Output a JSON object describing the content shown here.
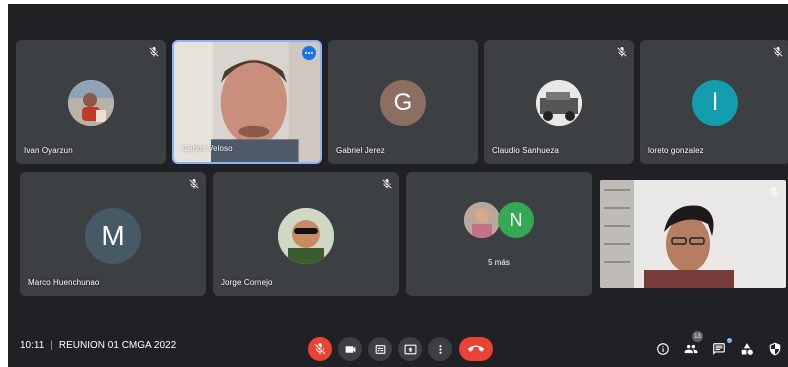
{
  "participants": [
    {
      "name": "Ivan Oyarzun",
      "avatar": "photo",
      "muted": true
    },
    {
      "name": "Carlos Veloso",
      "avatar": "video",
      "muted": false
    },
    {
      "name": "Gabriel Jerez",
      "avatar": "letter",
      "letter": "G",
      "color": "#8d6e63",
      "muted": false
    },
    {
      "name": "Claudio Sanhueza",
      "avatar": "photo",
      "muted": true
    },
    {
      "name": "loreto gonzalez",
      "avatar": "letter",
      "letter": "l",
      "color": "#129eaf",
      "muted": true
    },
    {
      "name": "Marco Huenchunao",
      "avatar": "letter",
      "letter": "M",
      "color": "#455a64",
      "muted": true
    },
    {
      "name": "Jorge Cornejo",
      "avatar": "photo",
      "muted": true
    },
    {
      "name": "",
      "avatar": "video",
      "muted": true
    }
  ],
  "more_tile": {
    "letter": "N",
    "color": "#34a853",
    "label": "5 más"
  },
  "bottom_bar": {
    "time": "10:11",
    "separator": "|",
    "meeting_name": "REUNION 01 CMGA 2022",
    "people_count": "13"
  },
  "colors": {
    "background": "#202124",
    "tile": "#3c4043",
    "accent": "#1a73e8",
    "danger": "#ea4335"
  },
  "icons": {
    "mic": "mic-off-icon",
    "camera": "videocam-icon",
    "captions": "closed-caption-icon",
    "present": "present-to-all-icon",
    "more": "more-vert-icon",
    "end": "call-end-icon",
    "info": "info-icon",
    "people": "people-icon",
    "chat": "chat-icon",
    "activities": "activities-icon",
    "host": "host-controls-icon"
  }
}
